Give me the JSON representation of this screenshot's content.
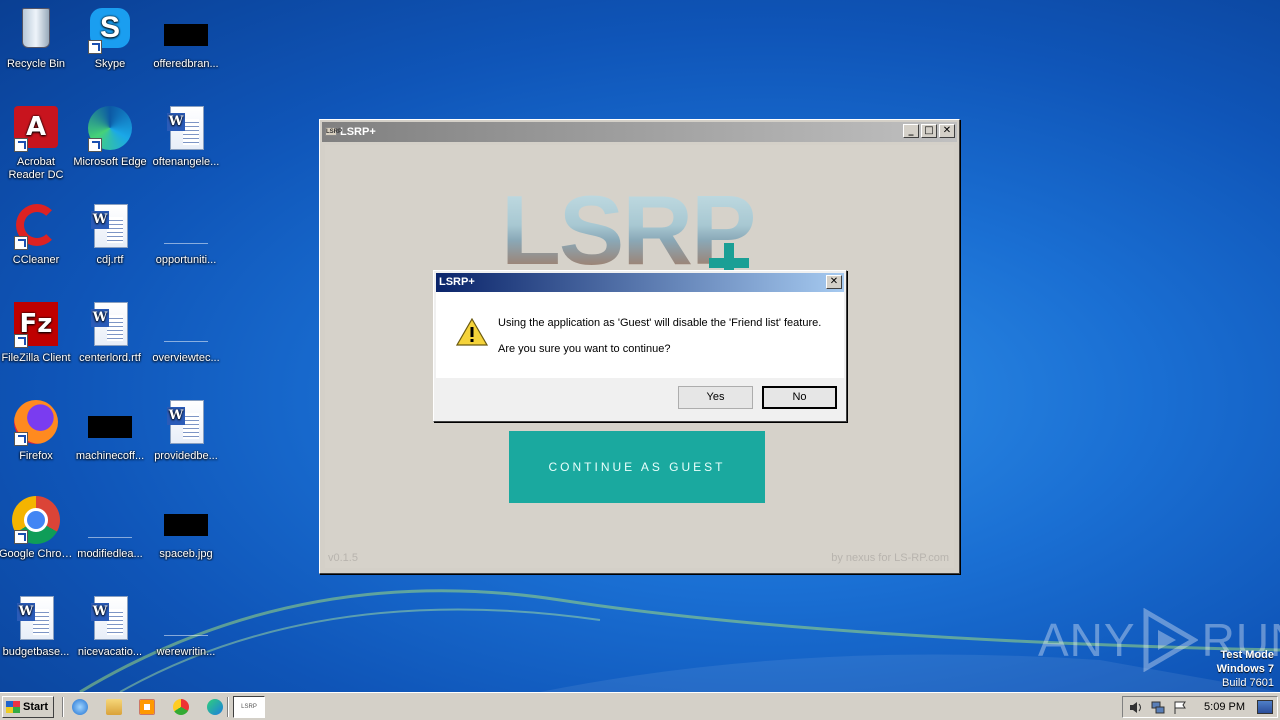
{
  "desktop": {
    "icons": [
      {
        "label": "Recycle Bin",
        "icon": "recycle-bin-icon"
      },
      {
        "label": "Skype",
        "icon": "skype-icon"
      },
      {
        "label": "offeredbran...",
        "icon": "black-image-file-icon"
      },
      {
        "label": "Acrobat Reader DC",
        "icon": "acrobat-icon"
      },
      {
        "label": "Microsoft Edge",
        "icon": "edge-icon"
      },
      {
        "label": "oftenangele...",
        "icon": "word-doc-icon"
      },
      {
        "label": "CCleaner",
        "icon": "ccleaner-icon"
      },
      {
        "label": "cdj.rtf",
        "icon": "word-doc-icon"
      },
      {
        "label": "opportuniti...",
        "icon": "blank-file-icon"
      },
      {
        "label": "FileZilla Client",
        "icon": "filezilla-icon"
      },
      {
        "label": "centerlord.rtf",
        "icon": "word-doc-icon"
      },
      {
        "label": "overviewtec...",
        "icon": "blank-file-icon"
      },
      {
        "label": "Firefox",
        "icon": "firefox-icon"
      },
      {
        "label": "machinecoff...",
        "icon": "black-image-file-icon"
      },
      {
        "label": "providedbe...",
        "icon": "word-doc-icon"
      },
      {
        "label": "Google Chrome",
        "icon": "chrome-icon"
      },
      {
        "label": "modifiedlea...",
        "icon": "blank-file-icon"
      },
      {
        "label": "spaceb.jpg",
        "icon": "black-image-file-icon"
      },
      {
        "label": "budgetbase...",
        "icon": "word-doc-icon"
      },
      {
        "label": "nicevacatio...",
        "icon": "word-doc-icon"
      },
      {
        "label": "werewritin...",
        "icon": "blank-file-icon"
      }
    ]
  },
  "app_window": {
    "title": "LSRP+",
    "logo_text": "LSRP",
    "continue_button": "CONTINUE AS GUEST",
    "version": "v0.1.5",
    "credit": "by nexus for LS-RP.com"
  },
  "dialog": {
    "title": "LSRP+",
    "message": "Using the application as 'Guest' will disable the 'Friend list' feature.",
    "question": "Are you sure you want to continue?",
    "yes_label": "Yes",
    "no_label": "No",
    "close_glyph": "✕"
  },
  "watermark": {
    "left": "ANY",
    "right": "RUN"
  },
  "os_info": {
    "line1": "Test Mode",
    "line2": "Windows 7",
    "line3": "Build 7601"
  },
  "taskbar": {
    "start_label": "Start",
    "task_item_label": "LSRP",
    "clock": "5:09 PM"
  }
}
